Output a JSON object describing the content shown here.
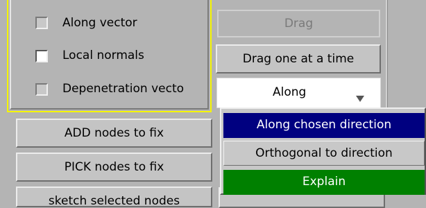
{
  "options": [
    {
      "label": "Along vector",
      "checked": false
    },
    {
      "label": "Local normals",
      "checked": true
    },
    {
      "label": "Depenetration vecto",
      "checked": false
    }
  ],
  "buttons": {
    "drag": "Drag",
    "drag_one": "Drag one at a time",
    "add_nodes": "ADD nodes to fix",
    "pick_nodes": "PICK nodes to fix",
    "sketch_nodes": "sketch selected nodes"
  },
  "direction_select": {
    "value": "Along"
  },
  "menu": {
    "items": [
      {
        "label": "Along chosen direction"
      },
      {
        "label": "Orthogonal to direction"
      },
      {
        "label": "Explain"
      }
    ]
  },
  "colors": {
    "panel_frame": "#f5f500",
    "menu_selected": "#000080",
    "menu_explain": "#008000",
    "background": "#b4b4b4"
  }
}
